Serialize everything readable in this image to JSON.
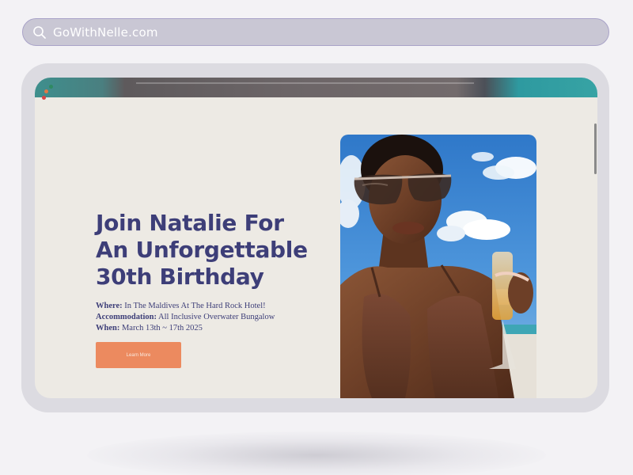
{
  "browser": {
    "url": "GoWithNelle.com"
  },
  "hero": {
    "headline_line1": "Join Natalie For",
    "headline_line2": "An Unforgettable",
    "headline_line3": "30th Birthday",
    "where_label": "Where:",
    "where_value": "In The Maldives At The Hard Rock Hotel!",
    "accommodation_label": "Accommodation:",
    "accommodation_value": "All Inclusive Overwater Bungalow",
    "when_label": "When:",
    "when_value": "March 13th ~ 17th 2025",
    "cta_label": "Learn More"
  },
  "icons": {
    "search": "search-icon",
    "dots": "app-dots-icon"
  },
  "colors": {
    "headline": "#3d3e78",
    "cta": "#ec8a5f",
    "page_bg": "#edeae4",
    "url_bar": "#c9c7d4"
  }
}
